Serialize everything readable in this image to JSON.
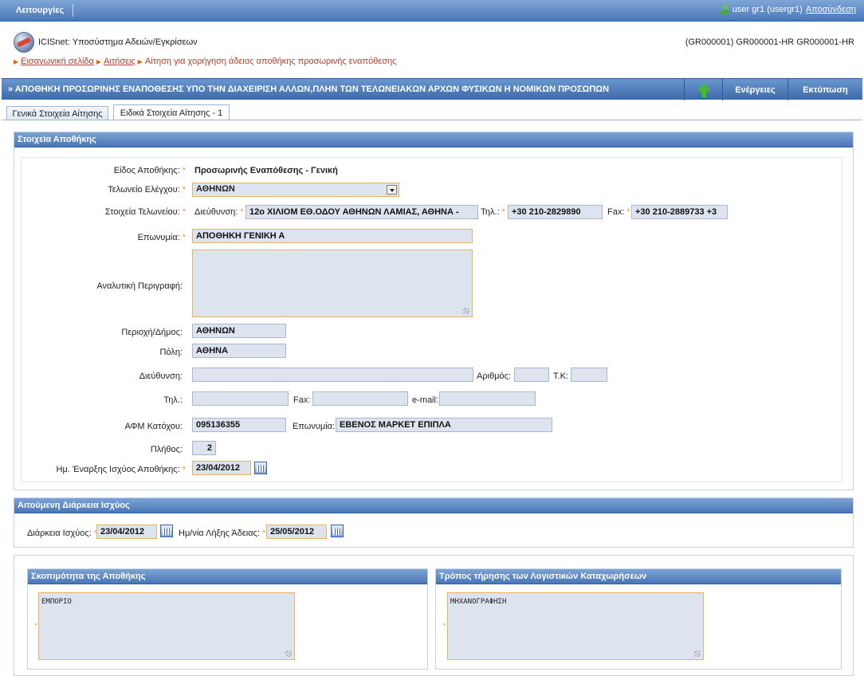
{
  "topbar": {
    "menu_label": "Λειτουργίες",
    "user_text": "user gr1 (usergr1)",
    "logout_label": "Αποσύνδεση"
  },
  "header": {
    "app_title": "ICISnet: Υποσύστημα Αδειών/Εγκρίσεων",
    "codes": "(GR000001) GR000001-HR GR000001-HR",
    "breadcrumb": {
      "home": "Εισαγωγική σελίδα",
      "applications": "Αιτήσεις",
      "current": "Αίτηση για χορήγηση άδειας αποθήκης προσωρινής εναπόθεσης"
    }
  },
  "titlebar": {
    "title": "» ΑΠΟΘΗΚΗ ΠΡΟΣΩΡΙΝΗΣ ΕΝΑΠΟΘΕΣΗΣ ΥΠΟ ΤΗΝ ΔΙΑΧΕΙΡΙΣΗ ΑΛΛΩΝ,ΠΛΗΝ ΤΩΝ ΤΕΛΩΝΕΙΑΚΩΝ ΑΡΧΩΝ ΦΥΣΙΚΩΝ Η ΝΟΜΙΚΩΝ ΠΡΟΣΩΠΩΝ",
    "actions_label": "Ενέργειες",
    "print_label": "Εκτύπωση"
  },
  "tabs": [
    {
      "label": "Γενικά Στοιχεία Αίτησης"
    },
    {
      "label": "Ειδικά Στοιχεία Αίτησης - 1"
    }
  ],
  "warehouse": {
    "section_title": "Στοιχεία Αποθήκης",
    "type_label": "Είδος Αποθήκης:",
    "type_value": "Προσωρινής Εναπόθεσης - Γενική",
    "office_label": "Τελωνείο Ελέγχου:",
    "office_value": "ΑΘΗΝΩΝ",
    "office_info_label": "Στοιχεία Τελωνείου:",
    "office_address_label": "Διεύθυνση:",
    "office_address_value": "12ο ΧΙΛΙΟΜ ΕΘ.ΟΔΟΥ ΑΘΗΝΩΝ ΛΑΜΙΑΣ, ΑΘΗΝΑ -",
    "office_phone_label": "Τηλ.:",
    "office_phone_value": "+30 210-2829890",
    "office_fax_label": "Fax:",
    "office_fax_value": "+30 210-2889733 +3",
    "name_label": "Επωνυμία:",
    "name_value": "ΑΠΟΘΗΚΗ ΓΕΝΙΚΗ Α",
    "description_label": "Αναλυτική Περιγραφή:",
    "region_label": "Περιοχή/Δήμος:",
    "region_value": "ΑΘΗΝΩΝ",
    "city_label": "Πόλη:",
    "city_value": "ΑΘΗΝΑ",
    "address_label": "Διεύθυνση:",
    "number_label": "Αριθμός:",
    "zip_label": "Τ.Κ:",
    "phone_label": "Τηλ.:",
    "fax_label": "Fax:",
    "email_label": "e-mail:",
    "afm_label": "ΑΦΜ Κατόχου:",
    "afm_value": "095136355",
    "owner_name_label": "Επωνυμία:",
    "owner_name_value": "ΕΒΕΝΟΣ ΜΑΡΚΕΤ ΕΠΙΠΛΑ",
    "count_label": "Πλήθος:",
    "count_value": "2",
    "start_date_label": "Ημ. Έναρξης Ισχύος Αποθήκης:",
    "start_date_value": "23/04/2012"
  },
  "duration": {
    "section_title": "Αιτούμενη Διάρκεια Ισχύος",
    "duration_label": "Διάρκεια Ισχύος:",
    "duration_value": "23/04/2012",
    "end_label": "Ημ/νία Λήξης Άδειας:",
    "end_value": "25/05/2012"
  },
  "purpose": {
    "section_title": "Σκοπιμότητα της Αποθήκης",
    "value": "ΕΜΠΟΡΙΟ"
  },
  "accounting": {
    "section_title": "Τρόπος τήρησης των Λογιστικών Καταχωρήσεων",
    "value": "ΜΗΧΑΝΟΓΡΑΦΗΣΗ"
  },
  "colors": {
    "header_blue": "#4a76b4",
    "field_bg": "#dde4ef",
    "required": "#e89a2b",
    "breadcrumb": "#c0392b"
  }
}
